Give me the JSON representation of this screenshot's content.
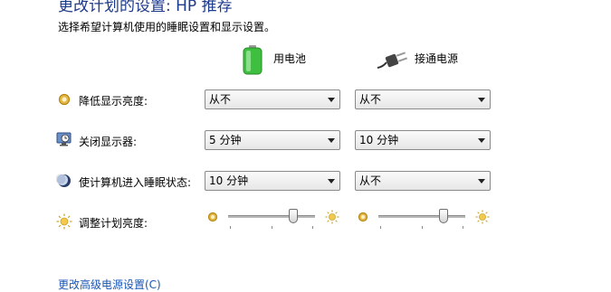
{
  "header": {
    "title": "更改计划的设置: HP 推荐",
    "subtitle": "选择希望计算机使用的睡眠设置和显示设置。"
  },
  "columns": {
    "battery_label": "用电池",
    "plugged_label": "接通电源",
    "battery_icon": "battery-icon",
    "plug_icon": "power-plug-icon"
  },
  "rows": [
    {
      "label": "降低显示亮度:",
      "icon": "dim-brightness-icon",
      "battery": "从不",
      "plugged": "从不"
    },
    {
      "label": "关闭显示器:",
      "icon": "monitor-clock-icon",
      "battery": "5 分钟",
      "plugged": "10 分钟"
    },
    {
      "label": "使计算机进入睡眠状态:",
      "icon": "sleep-moon-icon",
      "battery": "10 分钟",
      "plugged": "从不"
    }
  ],
  "brightness": {
    "label": "调整计划亮度:",
    "battery_level": 0.78,
    "plugged_level": 0.78
  },
  "footer": {
    "advanced_link": "更改高级电源设置(C)"
  },
  "colors": {
    "title": "#1e3a8a",
    "link": "#1a56b5",
    "battery_green": "#3fbf3f"
  }
}
